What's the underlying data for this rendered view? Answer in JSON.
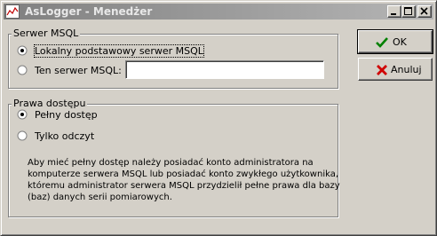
{
  "window": {
    "title": "AsLogger - Menedżer",
    "controls": [
      "minimize",
      "maximize",
      "close"
    ]
  },
  "server_group": {
    "title": "Serwer MSQL",
    "options": [
      {
        "label": "Lokalny podstawowy serwer MSQL",
        "selected": true
      },
      {
        "label": "Ten serwer MSQL:",
        "selected": false
      }
    ],
    "server_input": {
      "value": "",
      "placeholder": ""
    }
  },
  "access_group": {
    "title": "Prawa dostępu",
    "options": [
      {
        "label": "Pełny dostęp",
        "selected": true
      },
      {
        "label": "Tylko odczyt",
        "selected": false
      }
    ],
    "description_lines": [
      "Aby mieć pełny dostęp należy posiadać konto administratora na",
      "komputerze serwera MSQL lub posiadać konto zwykłego użytkownika,",
      "któremu administrator serwera MSQL przydzielił pełne prawa dla bazy",
      "(baz) danych serii pomiarowych."
    ]
  },
  "buttons": {
    "ok": {
      "label": "OK",
      "icon": "checkmark-icon",
      "icon_color": "#008000"
    },
    "cancel": {
      "label": "Anuluj",
      "icon": "x-icon",
      "icon_color": "#d00000"
    }
  }
}
